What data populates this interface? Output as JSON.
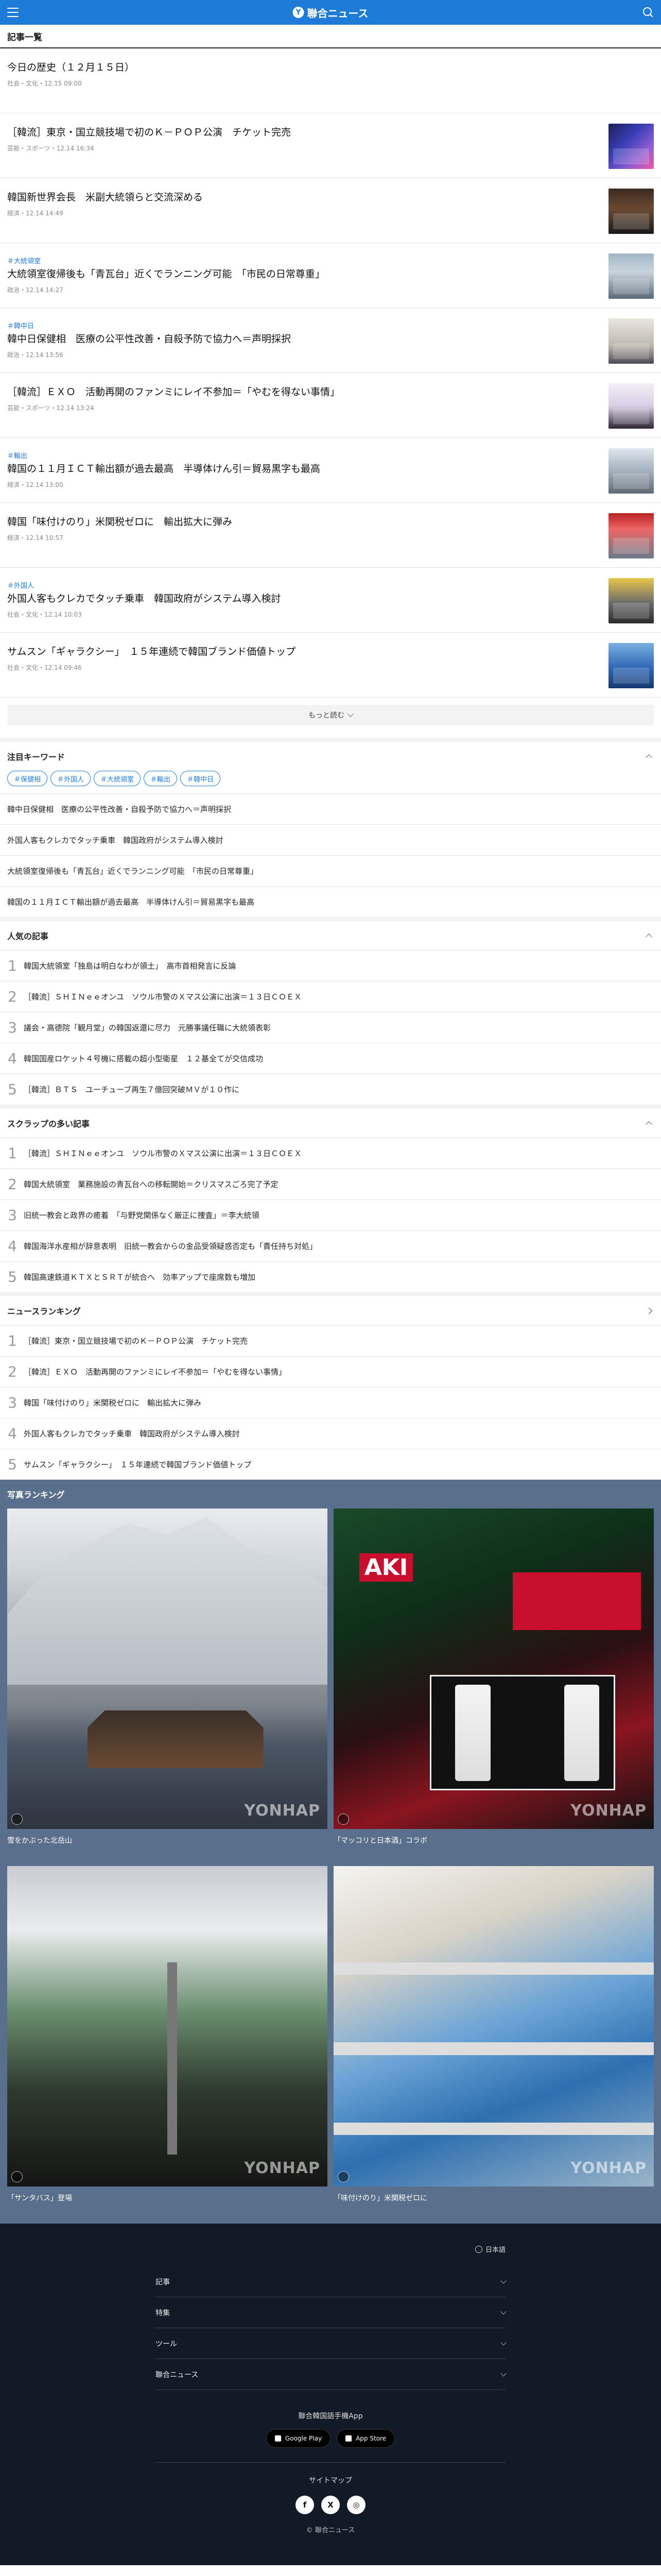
{
  "header": {
    "title": "聯合ニュース",
    "logo_mark": "Y"
  },
  "page_title": "記事一覧",
  "articles": [
    {
      "tag": "",
      "headline": "今日の歴史（１２月１５日）",
      "meta": "社会・文化・12.15 09:00",
      "has_thumb": false
    },
    {
      "tag": "",
      "headline": "［韓流］東京・国立競技場で初のＫ－ＰＯＰ公演　チケット完売",
      "meta": "芸能・スポーツ・12.14 16:34",
      "has_thumb": true
    },
    {
      "tag": "",
      "headline": "韓国新世界会長　米副大統領らと交流深める",
      "meta": "経済・12.14 14:49",
      "has_thumb": true
    },
    {
      "tag": "＃大統領室",
      "headline": "大統領室復帰後も「青瓦台」近くでランニング可能　「市民の日常尊重」",
      "meta": "政治・12.14 14:27",
      "has_thumb": true
    },
    {
      "tag": "＃韓中日",
      "headline": "韓中日保健相　医療の公平性改善・自殺予防で協力へ＝声明採択",
      "meta": "政治・12.14 13:56",
      "has_thumb": true
    },
    {
      "tag": "",
      "headline": "［韓流］ＥＸＯ　活動再開のファンミにレイ不参加＝「やむを得ない事情」",
      "meta": "芸能・スポーツ・12.14 13:24",
      "has_thumb": true
    },
    {
      "tag": "＃輸出",
      "headline": "韓国の１１月ＩＣＴ輸出額が過去最高　半導体けん引＝貿易黒字も最高",
      "meta": "経済・12.14 13:00",
      "has_thumb": true
    },
    {
      "tag": "",
      "headline": "韓国「味付けのり」米関税ゼロに　輸出拡大に弾み",
      "meta": "経済・12.14 10:57",
      "has_thumb": true
    },
    {
      "tag": "＃外国人",
      "headline": "外国人客もクレカでタッチ乗車　韓国政府がシステム導入検討",
      "meta": "社会・文化・12.14 10:03",
      "has_thumb": true
    },
    {
      "tag": "",
      "headline": "サムスン「ギャラクシー」　１５年連続で韓国ブランド価値トップ",
      "meta": "社会・文化・12.14 09:46",
      "has_thumb": true
    }
  ],
  "more_label": "もっと読む",
  "keywords": {
    "title": "注目キーワード",
    "tags": [
      "＃保健相",
      "＃外国人",
      "＃大統領室",
      "＃輸出",
      "＃韓中日"
    ],
    "items": [
      "韓中日保健相　医療の公平性改善・自殺予防で協力へ＝声明採択",
      "外国人客もクレカでタッチ乗車　韓国政府がシステム導入検討",
      "大統領室復帰後も「青瓦台」近くでランニング可能　「市民の日常尊重」",
      "韓国の１１月ＩＣＴ輸出額が過去最高　半導体けん引＝貿易黒字も最高"
    ]
  },
  "popular": {
    "title": "人気の記事",
    "items": [
      "韓国大統領室「独島は明白なわが領土」　高市首相発言に反論",
      "［韓流］ＳＨＩＮｅｅオンユ　ソウル市警のＸマス公演に出演＝１３日ＣＯＥＸ",
      "議会・高德院「観月堂」の韓国返還に尽力　元勝事議任職に大統領表彰",
      "韓国国産ロケット４号機に搭載の超小型衛星　１２基全てが交信成功",
      "［韓流］ＢＴＳ　ユーチューブ再生７億回突破ＭＶが１０作に"
    ]
  },
  "scrap": {
    "title": "スクラップの多い記事",
    "items": [
      "［韓流］ＳＨＩＮｅｅオンユ　ソウル市警のＸマス公演に出演＝１３日ＣＯＥＸ",
      "韓国大統領室　業務施設の青瓦台への移転開始＝クリスマスごろ完了予定",
      "旧統一教会と政界の癒着　「与野党関係なく厳正に捜査」＝李大統領",
      "韓国海洋水産相が辞意表明　旧統一教会からの金品受領疑惑否定も「責任持ち対処」",
      "韓国高速鉄道ＫＴＸとＳＲＴが統合へ　効率アップで座席数も増加"
    ]
  },
  "news_ranking": {
    "title": "ニュースランキング",
    "items": [
      "［韓流］東京・国立競技場で初のＫ－ＰＯＰ公演　チケット完売",
      "［韓流］ＥＸＯ　活動再開のファンミにレイ不参加＝「やむを得ない事情」",
      "韓国「味付けのり」米関税ゼロに　輸出拡大に弾み",
      "外国人客もクレカでタッチ乗車　韓国政府がシステム導入検討",
      "サムスン「ギャラクシー」　１５年連続で韓国ブランド価値トップ"
    ]
  },
  "rank_numbers": [
    "1",
    "2",
    "3",
    "4",
    "5"
  ],
  "photo_ranking": {
    "title": "写真ランキング",
    "watermark": "YONHAP",
    "photos": [
      {
        "caption": "雪をかぶった北岳山"
      },
      {
        "caption": "「マッコリと日本酒」コラボ"
      },
      {
        "caption": "「サンタバス」登場"
      },
      {
        "caption": "「味付けのり」米関税ゼロに"
      }
    ],
    "photo2_sign": "AKI"
  },
  "footer": {
    "language": "日本語",
    "menus": [
      "記事",
      "特集",
      "ツール",
      "聯合ニュース"
    ],
    "app_title": "聯合韓国語手機App",
    "stores": [
      "Google Play",
      "App Store"
    ],
    "sitemap": "サイトマップ",
    "social": [
      "f",
      "X",
      "◎"
    ],
    "copyright": "© 聯合ニュース"
  }
}
